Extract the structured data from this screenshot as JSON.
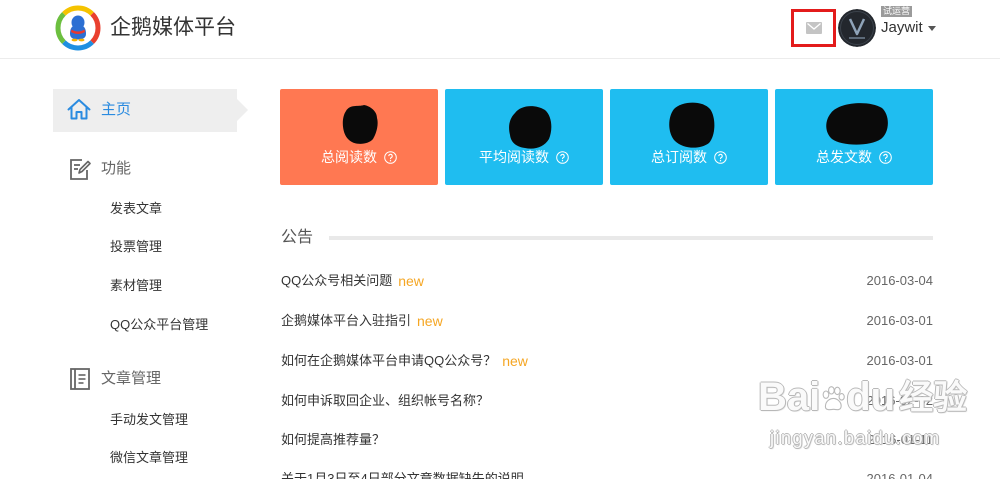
{
  "header": {
    "logo_icon": "penguin-media-logo",
    "title": "企鹅媒体平台",
    "mail_icon": "mail-icon",
    "avatar_icon": "user-avatar",
    "badge": "试运营",
    "username": "Jaywit",
    "caret_icon": "caret-down-icon"
  },
  "sidebar": {
    "home": {
      "label": "主页",
      "icon": "home-icon"
    },
    "sections": [
      {
        "label": "功能",
        "icon": "edit-document-icon",
        "items": [
          "发表文章",
          "投票管理",
          "素材管理",
          "QQ公众平台管理"
        ]
      },
      {
        "label": "文章管理",
        "icon": "document-list-icon",
        "items": [
          "手动发文管理",
          "微信文章管理"
        ]
      }
    ]
  },
  "stats": [
    {
      "label": "总阅读数",
      "icon": "question-circle-icon",
      "color": "#ff7852"
    },
    {
      "label": "平均阅读数",
      "icon": "question-circle-icon",
      "color": "#1fbdf0"
    },
    {
      "label": "总订阅数",
      "icon": "question-circle-icon",
      "color": "#1fbdf0"
    },
    {
      "label": "总发文数",
      "icon": "question-circle-icon",
      "color": "#1fbdf0"
    }
  ],
  "notice": {
    "title": "公告",
    "items": [
      {
        "title": "QQ公众号相关问题",
        "badge": "new",
        "date": "2016-03-04"
      },
      {
        "title": "企鹅媒体平台入驻指引",
        "badge": "new",
        "date": "2016-03-01"
      },
      {
        "title": "如何在企鹅媒体平台申请QQ公众号？",
        "badge": "new",
        "date": "2016-03-01"
      },
      {
        "title": "如何申诉取回企业、组织帐号名称？",
        "date": "2016-02-02"
      },
      {
        "title": "如何提高推荐量？",
        "date": "2016-01-11"
      },
      {
        "title": "关于1月3日至4日部分文章数据缺失的说明",
        "date": "2016-01-04"
      }
    ]
  },
  "watermark": {
    "brand_left": "Bai",
    "paw_icon": "baidu-paw-icon",
    "brand_right": "du",
    "brand_cn": "经验",
    "url": "jingyan.baidu.com"
  },
  "colors": {
    "accent": "#2a8be0",
    "badge_new": "#f5a623",
    "highlight": "#e31b1b"
  }
}
